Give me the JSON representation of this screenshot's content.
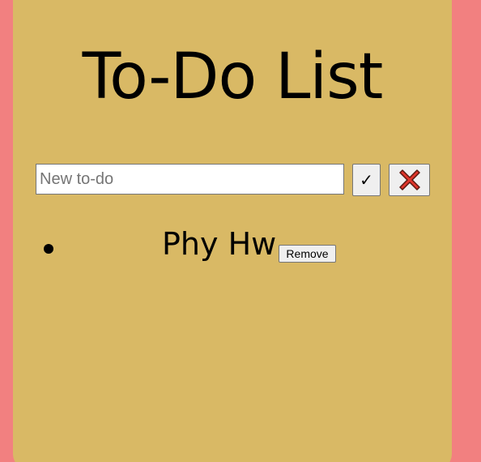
{
  "header": {
    "title": "To-Do List"
  },
  "new_todo": {
    "placeholder": "New to-do",
    "value": "",
    "confirm_label": "✓",
    "clear_icon": "red-x-icon"
  },
  "todos": [
    {
      "text": "Phy Hw",
      "remove_label": "Remove"
    }
  ],
  "colors": {
    "page_background": "#f28080",
    "card_background": "#d9b965",
    "clear_icon_fill": "#e0352b"
  }
}
